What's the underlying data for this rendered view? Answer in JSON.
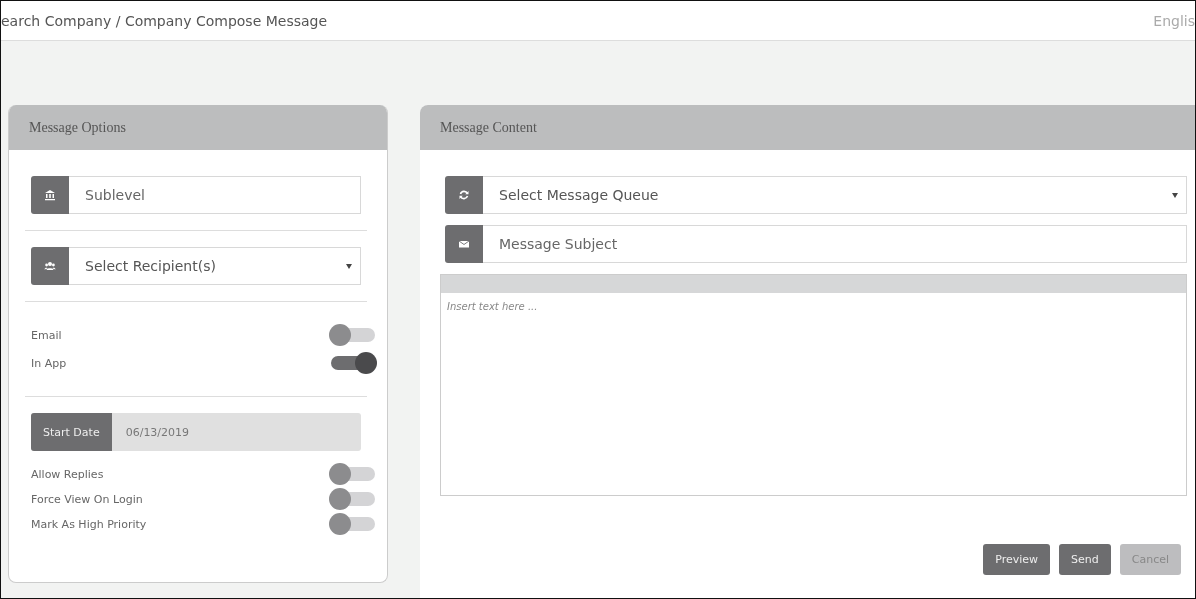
{
  "breadcrumb": "earch Company / Company Compose Message",
  "language": "Englis",
  "options_panel": {
    "title": "Message Options",
    "sublevel": {
      "placeholder": "Sublevel"
    },
    "recipients": {
      "value": "Select Recipient(s)"
    },
    "channels": [
      {
        "label": "Email",
        "on": false
      },
      {
        "label": "In App",
        "on": true
      }
    ],
    "start_date": {
      "label": "Start Date",
      "value": "06/13/2019"
    },
    "settings": [
      {
        "label": "Allow Replies",
        "on": false
      },
      {
        "label": "Force View On Login",
        "on": false
      },
      {
        "label": "Mark As High Priority",
        "on": false
      }
    ]
  },
  "content_panel": {
    "title": "Message Content",
    "queue": {
      "value": "Select Message Queue"
    },
    "subject": {
      "placeholder": "Message Subject"
    },
    "editor": {
      "placeholder": "Insert text here ..."
    },
    "buttons": [
      {
        "label": "Preview",
        "disabled": false
      },
      {
        "label": "Send",
        "disabled": false
      },
      {
        "label": "Cancel",
        "disabled": true
      }
    ]
  }
}
